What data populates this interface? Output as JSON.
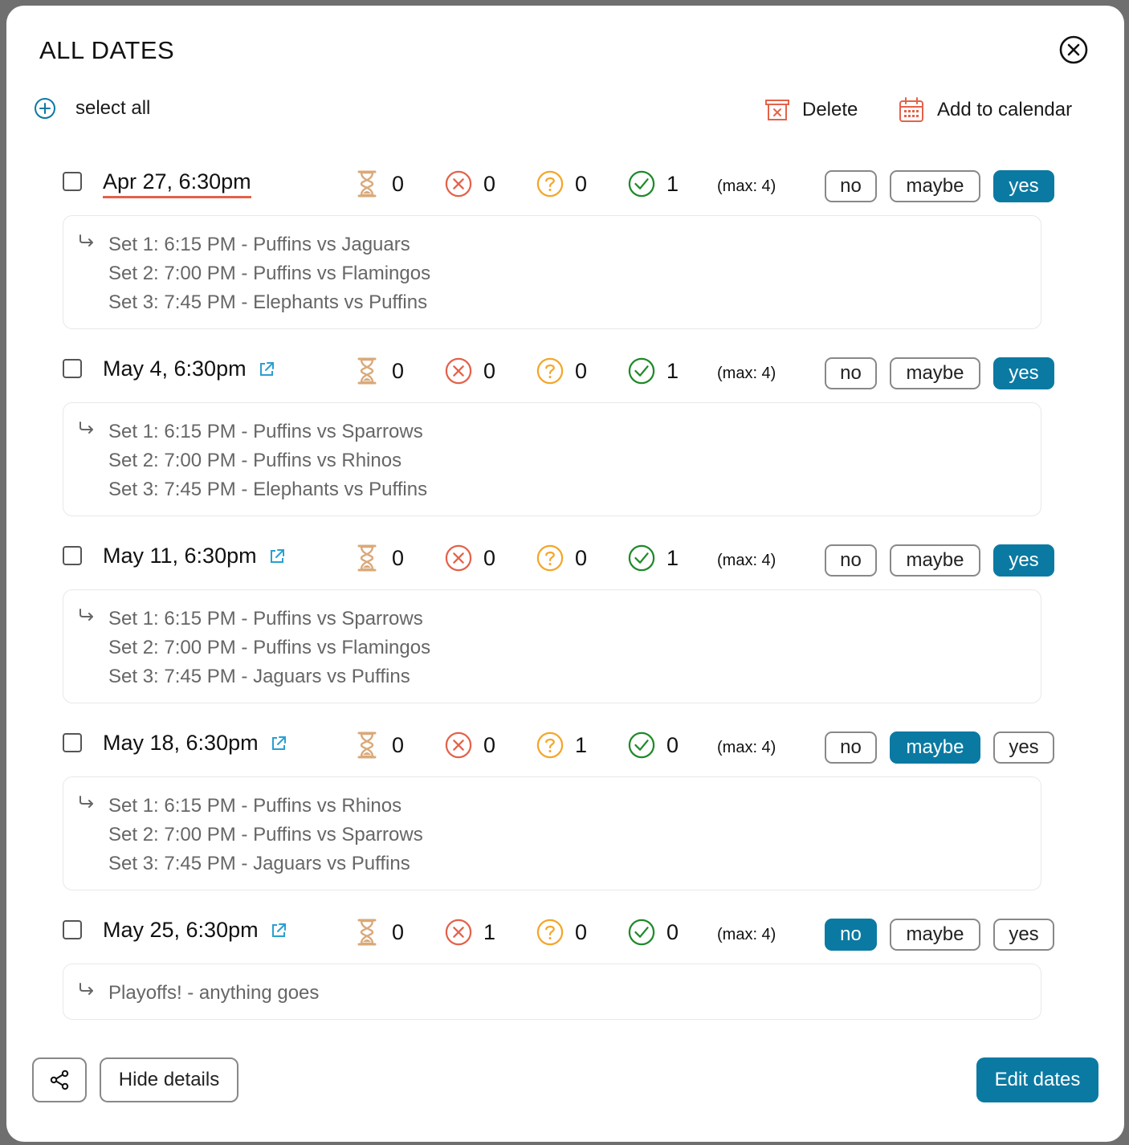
{
  "modal": {
    "title": "ALL DATES",
    "select_all_label": "select all",
    "delete_label": "Delete",
    "add_calendar_label": "Add to calendar"
  },
  "colors": {
    "accent": "#0a7aa3",
    "pending": "#d9a97a",
    "no": "#e4624a",
    "maybe": "#f4a62a",
    "yes": "#1f8a2a",
    "underline": "#e4624a"
  },
  "entries": [
    {
      "date": "Apr 27, 6:30pm",
      "pending": "0",
      "no": "0",
      "maybe": "0",
      "yes": "1",
      "max": "(max: 4)",
      "selected": "yes",
      "details": [
        "Set 1: 6:15 PM - Puffins vs Jaguars",
        "Set 2: 7:00 PM - Puffins vs Flamingos",
        "Set 3: 7:45 PM - Elephants vs Puffins"
      ]
    },
    {
      "date": "May 4, 6:30pm",
      "pending": "0",
      "no": "0",
      "maybe": "0",
      "yes": "1",
      "max": "(max: 4)",
      "selected": "yes",
      "details": [
        "Set 1: 6:15 PM - Puffins vs Sparrows",
        "Set 2: 7:00 PM - Puffins vs Rhinos",
        "Set 3: 7:45 PM - Elephants vs Puffins"
      ]
    },
    {
      "date": "May 11, 6:30pm",
      "pending": "0",
      "no": "0",
      "maybe": "0",
      "yes": "1",
      "max": "(max: 4)",
      "selected": "yes",
      "details": [
        "Set 1: 6:15 PM - Puffins vs Sparrows",
        "Set 2: 7:00 PM - Puffins vs Flamingos",
        "Set 3: 7:45 PM - Jaguars vs Puffins"
      ]
    },
    {
      "date": "May 18, 6:30pm",
      "pending": "0",
      "no": "0",
      "maybe": "1",
      "yes": "0",
      "max": "(max: 4)",
      "selected": "maybe",
      "details": [
        "Set 1: 6:15 PM - Puffins vs Rhinos",
        "Set 2: 7:00 PM - Puffins vs Sparrows",
        "Set 3: 7:45 PM - Jaguars vs Puffins"
      ]
    },
    {
      "date": "May 25, 6:30pm",
      "pending": "0",
      "no": "1",
      "maybe": "0",
      "yes": "0",
      "max": "(max: 4)",
      "selected": "no",
      "details": [
        "Playoffs! - anything goes"
      ]
    }
  ],
  "buttons": {
    "no": "no",
    "maybe": "maybe",
    "yes": "yes"
  },
  "footer": {
    "hide_details_label": "Hide details",
    "edit_dates_label": "Edit dates"
  }
}
